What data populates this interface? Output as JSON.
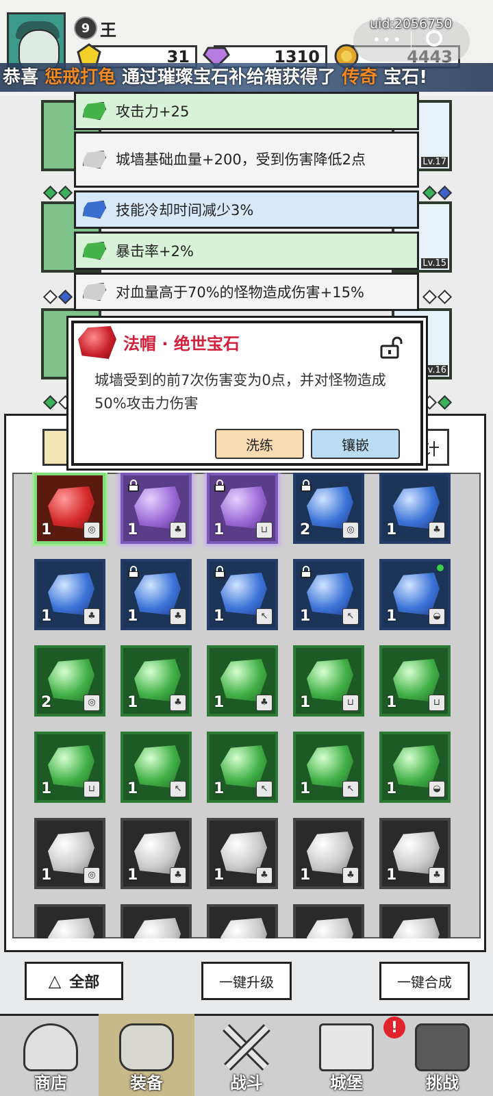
{
  "player": {
    "level": "9",
    "name": "王",
    "uid": "uid:2056750"
  },
  "resources": {
    "gold_gem": "31",
    "diamond": "1310",
    "coin": "4443"
  },
  "banner": {
    "prefix": "恭喜 ",
    "player": "惩戒打龟",
    "mid": " 通过璀璨宝石补给箱获得了 ",
    "rarity": "传奇",
    "suffix": " 宝石!"
  },
  "equip_levels": {
    "right1": "Lv.17",
    "right2": "Lv.15",
    "right3": "Lv.16"
  },
  "stats": [
    {
      "text": "攻击力+25",
      "color": "green"
    },
    {
      "text": "城墙基础血量+200，受到伤害降低2点",
      "color": "white"
    },
    {
      "text": "技能冷却时间减少3%",
      "color": "blue"
    },
    {
      "text": "暴击率+2%",
      "color": "green"
    },
    {
      "text": "对血量高于70%的怪物造成伤害+15%",
      "color": "white"
    }
  ],
  "popup": {
    "title": "法帽 · 绝世宝石",
    "description": "城墙受到的前7次伤害变为0点，并对怪物造成50%攻击力伤害",
    "refine_label": "洗练",
    "inlay_label": "镶嵌"
  },
  "gems": [
    {
      "color": "red",
      "count": "1",
      "type": "◎",
      "locked": false
    },
    {
      "color": "purple",
      "count": "1",
      "type": "♣",
      "locked": true
    },
    {
      "color": "purple",
      "count": "1",
      "type": "⊔",
      "locked": true
    },
    {
      "color": "blue",
      "count": "2",
      "type": "◎",
      "locked": true
    },
    {
      "color": "blue",
      "count": "1",
      "type": "♣",
      "locked": false
    },
    {
      "color": "blue",
      "count": "1",
      "type": "♣",
      "locked": false
    },
    {
      "color": "blue",
      "count": "1",
      "type": "♣",
      "locked": true
    },
    {
      "color": "blue",
      "count": "1",
      "type": "↖",
      "locked": true
    },
    {
      "color": "blue",
      "count": "1",
      "type": "↖",
      "locked": true
    },
    {
      "color": "blue",
      "count": "1",
      "type": "◒",
      "locked": false,
      "new": true
    },
    {
      "color": "green",
      "count": "2",
      "type": "◎",
      "locked": false
    },
    {
      "color": "green",
      "count": "1",
      "type": "♣",
      "locked": false
    },
    {
      "color": "green",
      "count": "1",
      "type": "♣",
      "locked": false
    },
    {
      "color": "green",
      "count": "1",
      "type": "⊔",
      "locked": false
    },
    {
      "color": "green",
      "count": "1",
      "type": "⊔",
      "locked": false
    },
    {
      "color": "green",
      "count": "1",
      "type": "⊔",
      "locked": false
    },
    {
      "color": "green",
      "count": "1",
      "type": "↖",
      "locked": false
    },
    {
      "color": "green",
      "count": "1",
      "type": "↖",
      "locked": false
    },
    {
      "color": "green",
      "count": "1",
      "type": "↖",
      "locked": false
    },
    {
      "color": "green",
      "count": "1",
      "type": "◒",
      "locked": false
    },
    {
      "color": "white",
      "count": "1",
      "type": "◎",
      "locked": false
    },
    {
      "color": "white",
      "count": "1",
      "type": "♣",
      "locked": false
    },
    {
      "color": "white",
      "count": "1",
      "type": "♣",
      "locked": false
    },
    {
      "color": "white",
      "count": "1",
      "type": "♣",
      "locked": false
    },
    {
      "color": "white",
      "count": "1",
      "type": "♣",
      "locked": false
    },
    {
      "color": "white",
      "count": "",
      "type": "",
      "locked": false
    },
    {
      "color": "white",
      "count": "",
      "type": "",
      "locked": false
    },
    {
      "color": "white",
      "count": "",
      "type": "",
      "locked": false
    },
    {
      "color": "white",
      "count": "",
      "type": "",
      "locked": false
    },
    {
      "color": "white",
      "count": "",
      "type": "",
      "locked": false
    }
  ],
  "actions": {
    "filter": "全部",
    "upgrade_all": "一键升级",
    "merge_all": "一键合成",
    "panel_tab_right": "计"
  },
  "nav": {
    "shop": "商店",
    "equip": "装备",
    "battle": "战斗",
    "castle": "城堡",
    "challenge": "挑战",
    "badge": "!"
  }
}
